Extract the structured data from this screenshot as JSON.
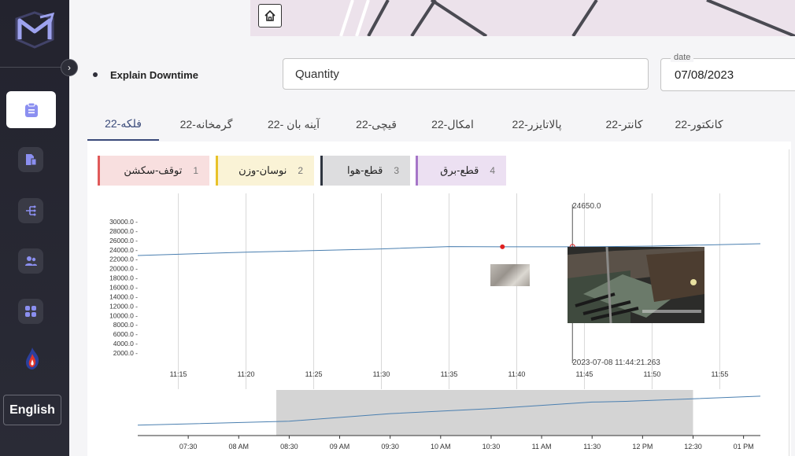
{
  "sidebar": {
    "language": "English",
    "nav": [
      {
        "icon": "clipboard-icon",
        "active": true
      },
      {
        "icon": "document-report-icon",
        "active": false
      },
      {
        "icon": "flow-branch-icon",
        "active": false
      },
      {
        "icon": "users-icon",
        "active": false
      },
      {
        "icon": "grid-apps-icon",
        "active": false
      },
      {
        "icon": "flame-icon",
        "active": false
      }
    ]
  },
  "toolbar": {
    "home_icon": "home-icon"
  },
  "filters": {
    "section_title": "Explain Downtime",
    "quantity_value": "Quantity",
    "date_label": "date",
    "date_value": "07/08/2023"
  },
  "tabs": [
    {
      "label": "فلکه-22",
      "active": true
    },
    {
      "label": "گرمخانه-22",
      "active": false
    },
    {
      "label": "آینه بان -22",
      "active": false
    },
    {
      "label": "قیچی-22",
      "active": false
    },
    {
      "label": "امکال-22",
      "active": false
    },
    {
      "label": "پالاتایزر-22",
      "active": false
    },
    {
      "label": "کانتر-22",
      "active": false
    },
    {
      "label": "کانکتور-22",
      "active": false
    }
  ],
  "legend": [
    {
      "num": "1",
      "label": "توقف-سکشن",
      "color": "#e05a5a",
      "bg": "#f8dfdf"
    },
    {
      "num": "2",
      "label": "نوسان-وزن",
      "color": "#e8c22a",
      "bg": "#faf3d6"
    },
    {
      "num": "3",
      "label": "قطع-هوا",
      "color": "#2f3540",
      "bg": "#dddddf"
    },
    {
      "num": "4",
      "label": "قطع-برق",
      "color": "#a676c8",
      "bg": "#ece0f2"
    }
  ],
  "colors": {
    "line": "#4a7fb0",
    "point": "#e02020"
  },
  "chart_data": {
    "type": "line",
    "main": {
      "x_ticks": [
        "11:15",
        "11:20",
        "11:25",
        "11:30",
        "11:35",
        "11:40",
        "11:45",
        "11:50",
        "11:55"
      ],
      "y_ticks": [
        "30000.0",
        "28000.0",
        "26000.0",
        "24000.0",
        "22000.0",
        "20000.0",
        "18000.0",
        "16000.0",
        "14000.0",
        "12000.0",
        "10000.0",
        "8000.0",
        "6000.0",
        "4000.0",
        "2000.0"
      ],
      "ylim": [
        0,
        31000
      ],
      "x_range_minutes": [
        [
          11,
          12
        ],
        [
          11,
          58
        ]
      ],
      "points": [
        {
          "t": "11:12",
          "y": 22800
        },
        {
          "t": "11:20",
          "y": 23500
        },
        {
          "t": "11:30",
          "y": 24200
        },
        {
          "t": "11:35",
          "y": 24700
        },
        {
          "t": "11:40",
          "y": 24650
        },
        {
          "t": "11:45",
          "y": 24650
        },
        {
          "t": "11:50",
          "y": 24800
        },
        {
          "t": "11:58",
          "y": 25300
        }
      ],
      "highlight": {
        "t": "11:39",
        "y": 24650
      },
      "cursor": {
        "t": "11:44",
        "label_value": "24650.0",
        "label_time": "2023-07-08 11:44:21.263"
      }
    },
    "overview": {
      "x_ticks": [
        "07:30",
        "08 AM",
        "08:30",
        "09 AM",
        "09:30",
        "10 AM",
        "10:30",
        "11 AM",
        "11:30",
        "12 PM",
        "12:30",
        "01 PM"
      ],
      "points": [
        {
          "t": "07:00",
          "y": 0.1
        },
        {
          "t": "08:30",
          "y": 0.22
        },
        {
          "t": "09:30",
          "y": 0.45
        },
        {
          "t": "10:30",
          "y": 0.6
        },
        {
          "t": "11:30",
          "y": 0.8
        },
        {
          "t": "11:50",
          "y": 0.82
        },
        {
          "t": "12:30",
          "y": 0.9
        },
        {
          "t": "13:10",
          "y": 0.98
        }
      ],
      "brush": [
        "08:20",
        "12:30"
      ]
    }
  }
}
